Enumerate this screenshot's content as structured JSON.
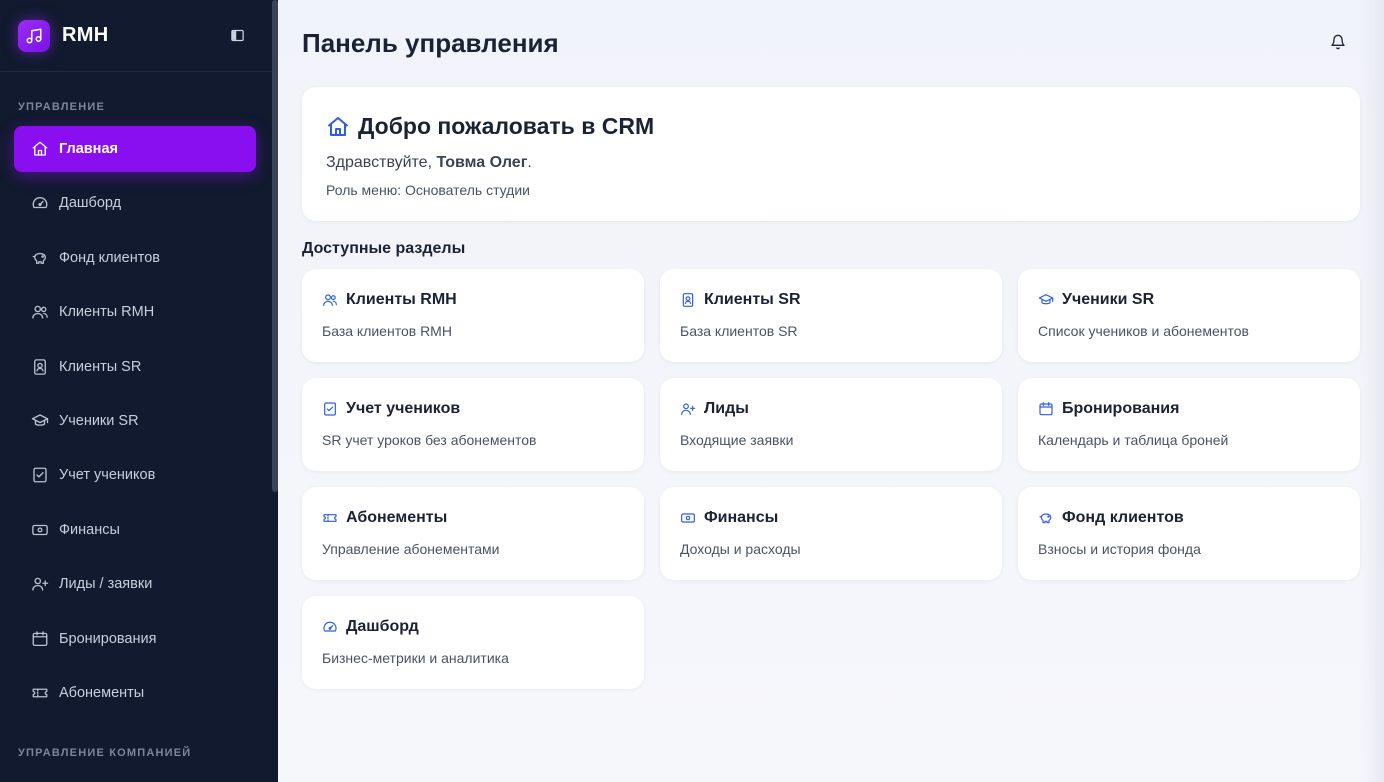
{
  "brand": {
    "name": "RMH"
  },
  "sidebar": {
    "section_main": "Управление",
    "section_company": "Управление компанией",
    "items": [
      {
        "label": "Главная",
        "icon": "home-icon",
        "active": true
      },
      {
        "label": "Дашборд",
        "icon": "gauge-icon"
      },
      {
        "label": "Фонд клиентов",
        "icon": "piggy-bank-icon"
      },
      {
        "label": "Клиенты RMH",
        "icon": "users-icon"
      },
      {
        "label": "Клиенты SR",
        "icon": "contact-card-icon"
      },
      {
        "label": "Ученики SR",
        "icon": "graduation-cap-icon"
      },
      {
        "label": "Учет учеников",
        "icon": "checklist-icon"
      },
      {
        "label": "Финансы",
        "icon": "banknote-icon"
      },
      {
        "label": "Лиды / заявки",
        "icon": "user-plus-icon"
      },
      {
        "label": "Бронирования",
        "icon": "calendar-icon"
      },
      {
        "label": "Абонементы",
        "icon": "ticket-icon"
      }
    ]
  },
  "header": {
    "title": "Панель управления"
  },
  "welcome": {
    "title": "Добро пожаловать в CRM",
    "greeting_prefix": "Здравствуйте, ",
    "user_name": "Товма Олег",
    "greeting_suffix": ".",
    "role_text": "Роль меню: Основатель студии"
  },
  "sections": {
    "title": "Доступные разделы",
    "cards": [
      {
        "title": "Клиенты RMH",
        "desc": "База клиентов RMH",
        "icon": "users-icon"
      },
      {
        "title": "Клиенты SR",
        "desc": "База клиентов SR",
        "icon": "contact-card-icon"
      },
      {
        "title": "Ученики SR",
        "desc": "Список учеников и абонементов",
        "icon": "graduation-cap-icon"
      },
      {
        "title": "Учет учеников",
        "desc": "SR учет уроков без абонементов",
        "icon": "checklist-icon"
      },
      {
        "title": "Лиды",
        "desc": "Входящие заявки",
        "icon": "user-plus-icon"
      },
      {
        "title": "Бронирования",
        "desc": "Календарь и таблица броней",
        "icon": "calendar-icon"
      },
      {
        "title": "Абонементы",
        "desc": "Управление абонементами",
        "icon": "ticket-icon"
      },
      {
        "title": "Финансы",
        "desc": "Доходы и расходы",
        "icon": "banknote-icon"
      },
      {
        "title": "Фонд клиентов",
        "desc": "Взносы и история фонда",
        "icon": "piggy-bank-icon"
      },
      {
        "title": "Дашборд",
        "desc": "Бизнес-метрики и аналитика",
        "icon": "gauge-icon"
      }
    ]
  },
  "colors": {
    "accent": "#8a0ff0",
    "sidebar_bg": "#111a2e",
    "icon_blue": "#2f5fe0"
  }
}
